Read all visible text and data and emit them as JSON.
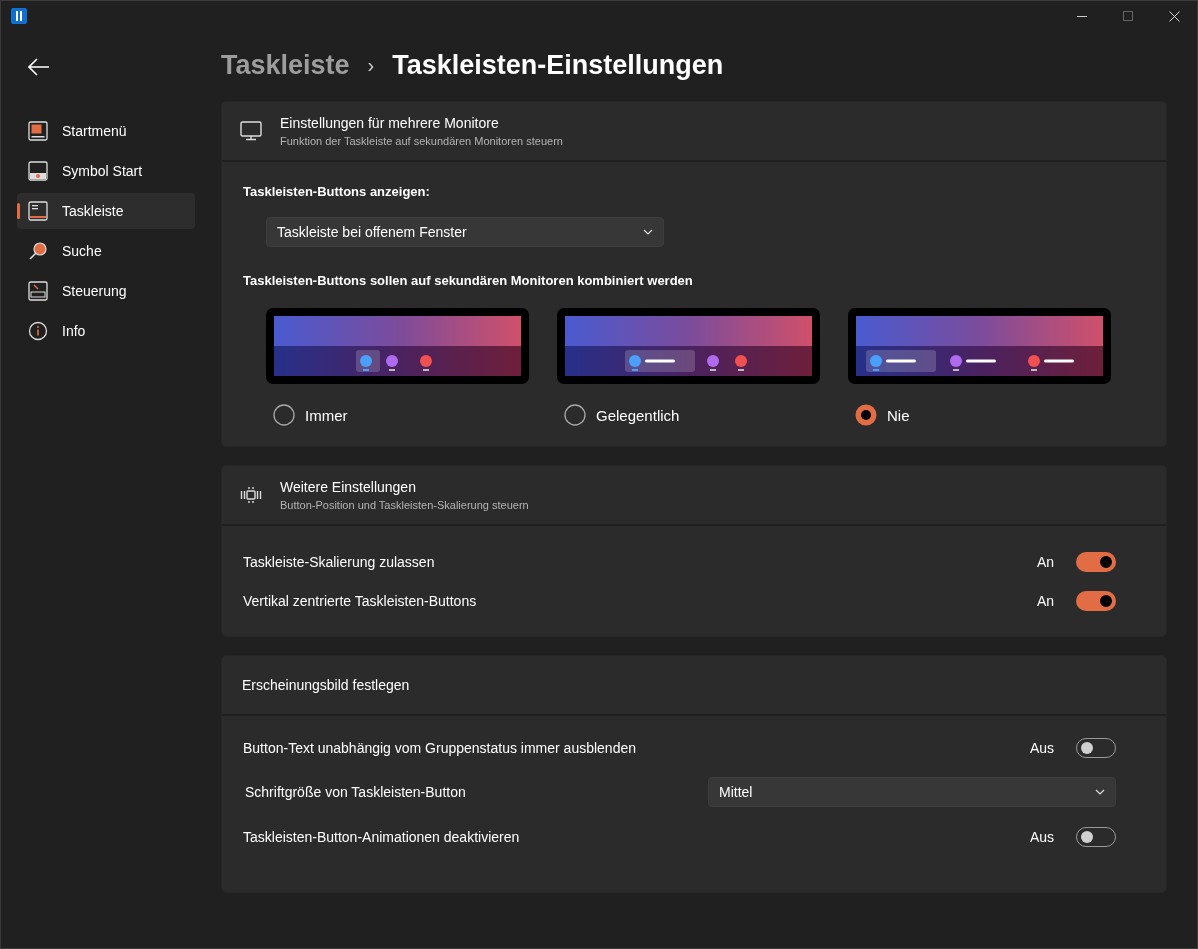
{
  "sidebar": {
    "items": [
      {
        "label": "Startmenü",
        "selected": false
      },
      {
        "label": "Symbol Start",
        "selected": false
      },
      {
        "label": "Taskleiste",
        "selected": true
      },
      {
        "label": "Suche",
        "selected": false
      },
      {
        "label": "Steuerung",
        "selected": false
      },
      {
        "label": "Info",
        "selected": false
      }
    ]
  },
  "breadcrumb": {
    "parent": "Taskleiste",
    "separator": "›",
    "current": "Taskleisten-Einstellungen"
  },
  "monitors": {
    "title": "Einstellungen für mehrere Monitore",
    "subtitle": "Funktion der Taskleiste auf sekundären Monitoren steuern",
    "show_label": "Taskleisten-Buttons anzeigen:",
    "show_value": "Taskleiste bei offenem Fenster",
    "combine_label": "Taskleisten-Buttons sollen auf sekundären Monitoren kombiniert werden",
    "options": [
      {
        "label": "Immer",
        "selected": false,
        "kind": "compact"
      },
      {
        "label": "Gelegentlich",
        "selected": false,
        "kind": "partial"
      },
      {
        "label": "Nie",
        "selected": true,
        "kind": "full"
      }
    ]
  },
  "more": {
    "title": "Weitere Einstellungen",
    "subtitle": "Button-Position und Taskleisten-Skalierung steuern",
    "rows": [
      {
        "kind": "toggle",
        "label": "Taskleiste-Skalierung zulassen",
        "state_text": "An",
        "on": true
      },
      {
        "kind": "toggle",
        "label": "Vertikal zentrierte Taskleisten-Buttons",
        "state_text": "An",
        "on": true
      }
    ]
  },
  "appearance": {
    "title": "Erscheinungsbild festlegen",
    "rows": [
      {
        "kind": "toggle",
        "label": "Button-Text unabhängig vom Gruppenstatus immer ausblenden",
        "state_text": "Aus",
        "on": false
      },
      {
        "kind": "dropdown",
        "label": "Schriftgröße von Taskleisten-Button",
        "value": "Mittel"
      },
      {
        "kind": "toggle",
        "label": "Taskleisten-Button-Animationen deaktivieren",
        "state_text": "Aus",
        "on": false
      }
    ]
  }
}
